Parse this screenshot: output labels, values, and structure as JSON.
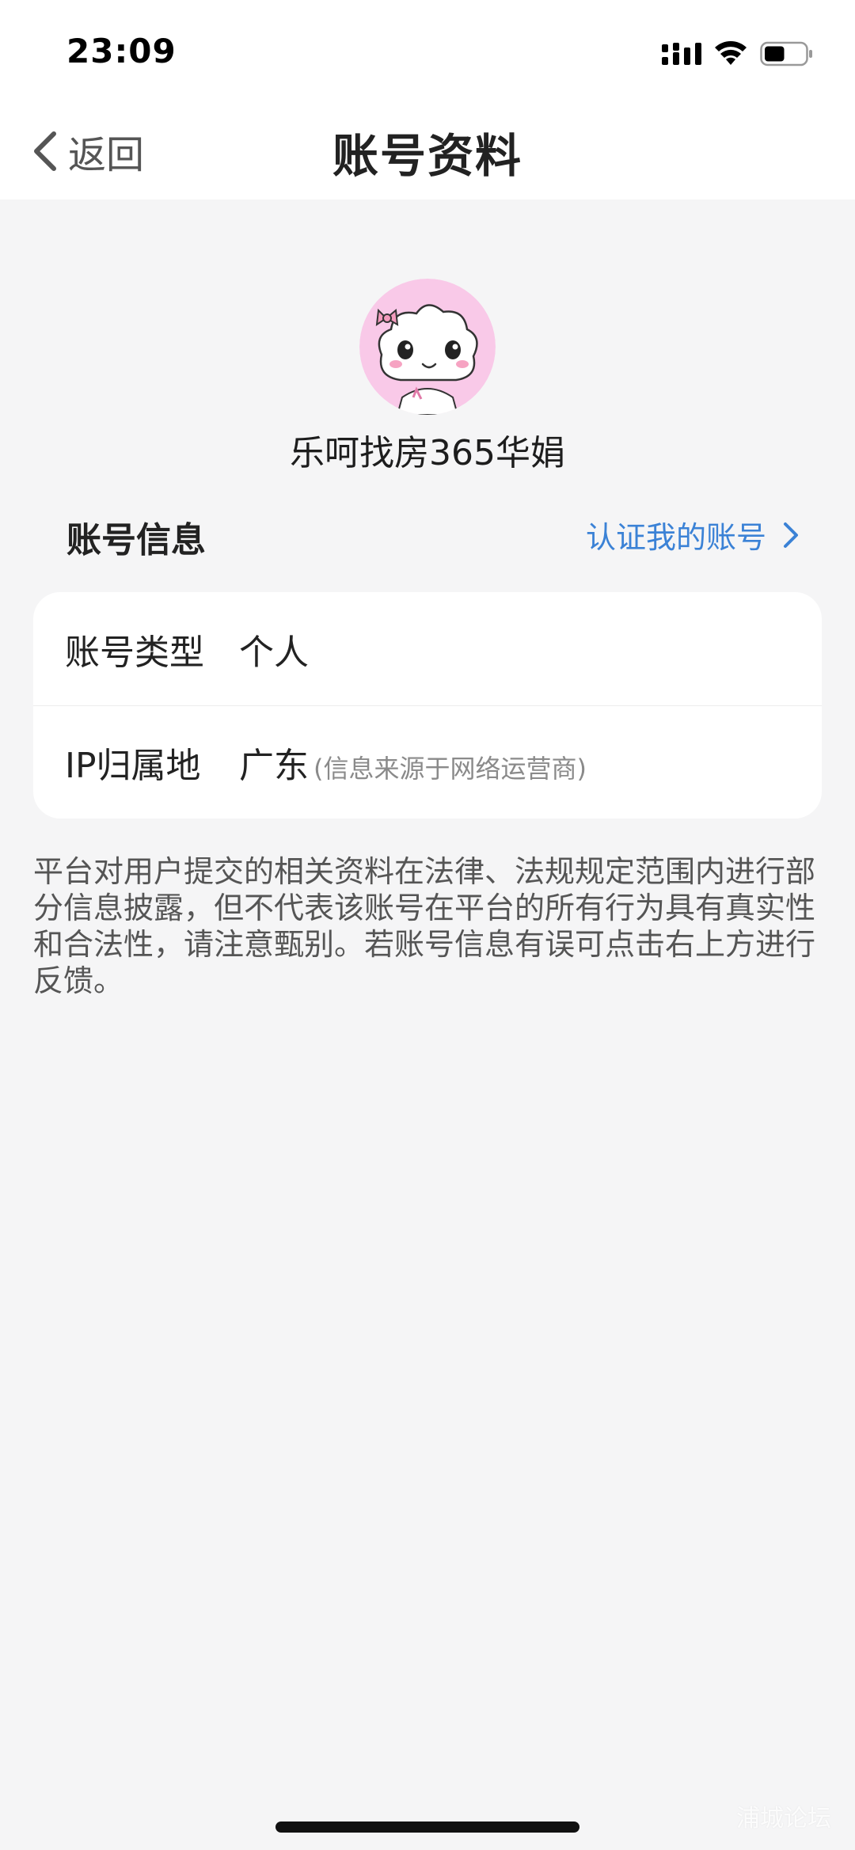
{
  "status_bar": {
    "time": "23:09",
    "icons": [
      "cellular-signal-icon",
      "wifi-icon",
      "battery-icon"
    ],
    "battery_level": 0.5
  },
  "nav": {
    "back_label": "返回",
    "title": "账号资料"
  },
  "profile": {
    "avatar": "cloud-girl-avatar",
    "nickname": "乐呵找房365华娟"
  },
  "account_info": {
    "section_title": "账号信息",
    "verify_link": "认证我的账号",
    "rows": [
      {
        "label": "账号类型",
        "value": "个人",
        "hint": ""
      },
      {
        "label": "IP归属地",
        "value": "广东",
        "hint": "(信息来源于网络运营商)"
      }
    ]
  },
  "notice": "平台对用户提交的相关资料在法律、法规规定范围内进行部分信息披露，但不代表该账号在平台的所有行为具有真实性和合法性，请注意甄别。若账号信息有误可点击右上方进行反馈。",
  "watermark": "浦城论坛",
  "colors": {
    "accent": "#3b82d6",
    "background": "#f5f5f6",
    "card": "#ffffff",
    "avatar_bg": "#f9c9e8"
  }
}
